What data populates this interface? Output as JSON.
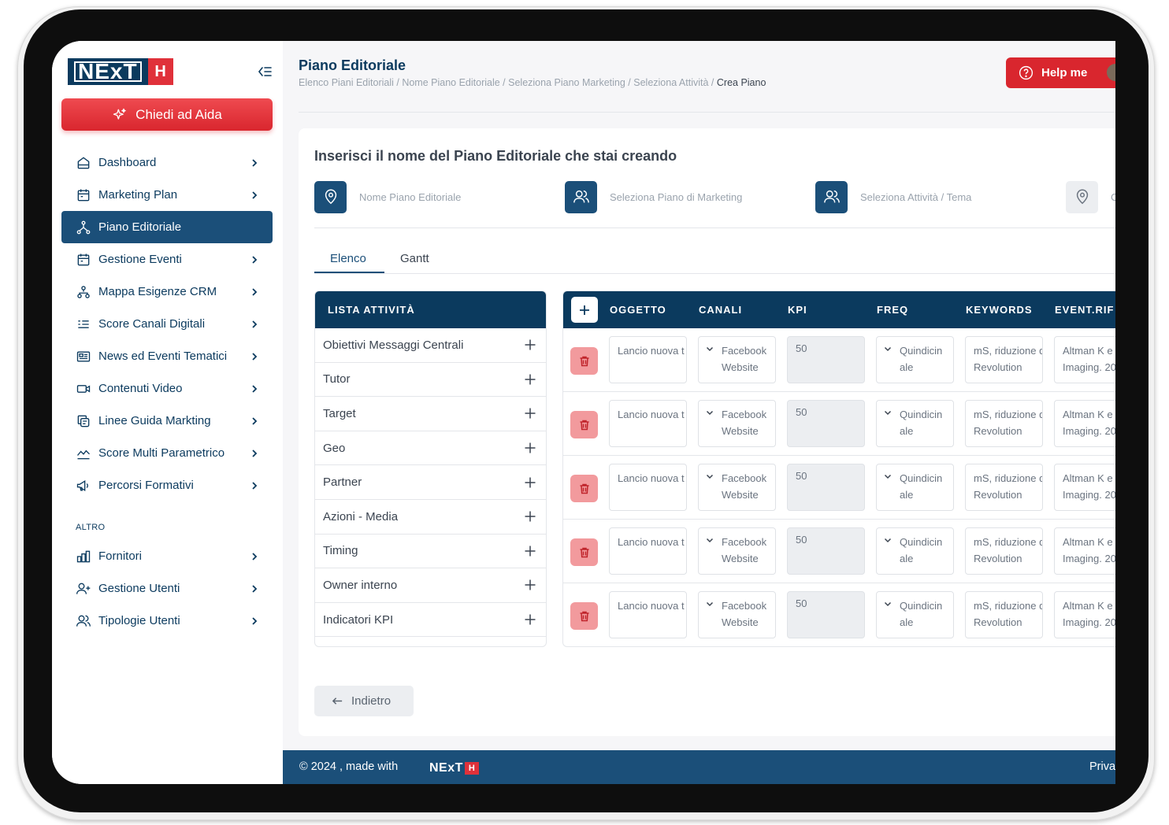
{
  "brand": {
    "logo_text": "NExT",
    "logo_badge": "H",
    "accent": "#d9262e",
    "navy": "#0b3a5e"
  },
  "sidebar": {
    "aida_label": "Chiedi ad Aida",
    "items": [
      {
        "label": "Dashboard",
        "icon": "home-icon",
        "active": false
      },
      {
        "label": "Marketing Plan",
        "icon": "calendar-icon",
        "active": false
      },
      {
        "label": "Piano Editoriale",
        "icon": "hierarchy-icon",
        "active": true
      },
      {
        "label": "Gestione Eventi",
        "icon": "calendar-icon",
        "active": false
      },
      {
        "label": "Mappa Esigenze CRM",
        "icon": "org-chart-icon",
        "active": false
      },
      {
        "label": "Score Canali Digitali",
        "icon": "list-icon",
        "active": false
      },
      {
        "label": "News ed Eventi Tematici",
        "icon": "newspaper-icon",
        "active": false
      },
      {
        "label": "Contenuti Video",
        "icon": "video-icon",
        "active": false
      },
      {
        "label": "Linee Guida Markting",
        "icon": "copy-icon",
        "active": false
      },
      {
        "label": "Score Multi Parametrico",
        "icon": "trend-icon",
        "active": false
      },
      {
        "label": "Percorsi Formativi",
        "icon": "megaphone-icon",
        "active": false
      }
    ],
    "section_label": "ALTRO",
    "other_items": [
      {
        "label": "Fornitori",
        "icon": "bar-chart-icon"
      },
      {
        "label": "Gestione Utenti",
        "icon": "user-plus-icon"
      },
      {
        "label": "Tipologie Utenti",
        "icon": "users-icon"
      }
    ]
  },
  "header": {
    "title": "Piano Editoriale",
    "breadcrumb": [
      "Elenco Piani Editoriali",
      "Nome Piano Editoriale",
      "Seleziona Piano Marketing",
      "Seleziona Attività"
    ],
    "breadcrumb_current": "Crea Piano",
    "help_label": "Help me"
  },
  "card": {
    "title": "Inserisci il nome del Piano Editoriale che stai creando",
    "steps": [
      {
        "label": "Nome Piano Editoriale",
        "icon": "location-pin-icon"
      },
      {
        "label": "Seleziona Piano di Marketing",
        "icon": "users-icon"
      },
      {
        "label": "Seleziona Attività / Tema",
        "icon": "users-icon"
      },
      {
        "label": "C",
        "icon": "location-pin-icon"
      }
    ],
    "tabs": [
      "Elenco",
      "Gantt"
    ],
    "active_tab": "Elenco"
  },
  "lista": {
    "header": "LISTA ATTIVITÀ",
    "items": [
      "Obiettivi Messaggi Centrali",
      "Tutor",
      "Target",
      "Geo",
      "Partner",
      "Azioni - Media",
      "Timing",
      "Owner interno",
      "Indicatori KPI"
    ]
  },
  "table": {
    "columns": [
      "OGGETTO",
      "CANALI",
      "KPI",
      "FREQ",
      "KEYWORDS",
      "EVENT.RIF"
    ],
    "rows": [
      {
        "oggetto": "Lancio nuova t",
        "canali_1": "Facebook",
        "canali_2": "Website",
        "kpi": "50",
        "freq_1": "Quindicin",
        "freq_2": "ale",
        "keywords_1": "mS, riduzione d",
        "keywords_2": "Revolution",
        "event_1": "Altman K e",
        "event_2": "Imaging. 20"
      },
      {
        "oggetto": "Lancio nuova t",
        "canali_1": "Facebook",
        "canali_2": "Website",
        "kpi": "50",
        "freq_1": "Quindicin",
        "freq_2": "ale",
        "keywords_1": "mS, riduzione d",
        "keywords_2": "Revolution",
        "event_1": "Altman K e",
        "event_2": "Imaging. 20"
      },
      {
        "oggetto": "Lancio nuova t",
        "canali_1": "Facebook",
        "canali_2": "Website",
        "kpi": "50",
        "freq_1": "Quindicin",
        "freq_2": "ale",
        "keywords_1": "mS, riduzione d",
        "keywords_2": "Revolution",
        "event_1": "Altman K e",
        "event_2": "Imaging. 20"
      },
      {
        "oggetto": "Lancio nuova t",
        "canali_1": "Facebook",
        "canali_2": "Website",
        "kpi": "50",
        "freq_1": "Quindicin",
        "freq_2": "ale",
        "keywords_1": "mS, riduzione d",
        "keywords_2": "Revolution",
        "event_1": "Altman K e",
        "event_2": "Imaging. 20"
      },
      {
        "oggetto": "Lancio nuova t",
        "canali_1": "Facebook",
        "canali_2": "Website",
        "kpi": "50",
        "freq_1": "Quindicin",
        "freq_2": "ale",
        "keywords_1": "mS, riduzione d",
        "keywords_2": "Revolution",
        "event_1": "Altman K e",
        "event_2": "Imaging. 20"
      }
    ]
  },
  "back_label": "Indietro",
  "footer": {
    "text": "© 2024 , made with",
    "right": "Priva"
  }
}
